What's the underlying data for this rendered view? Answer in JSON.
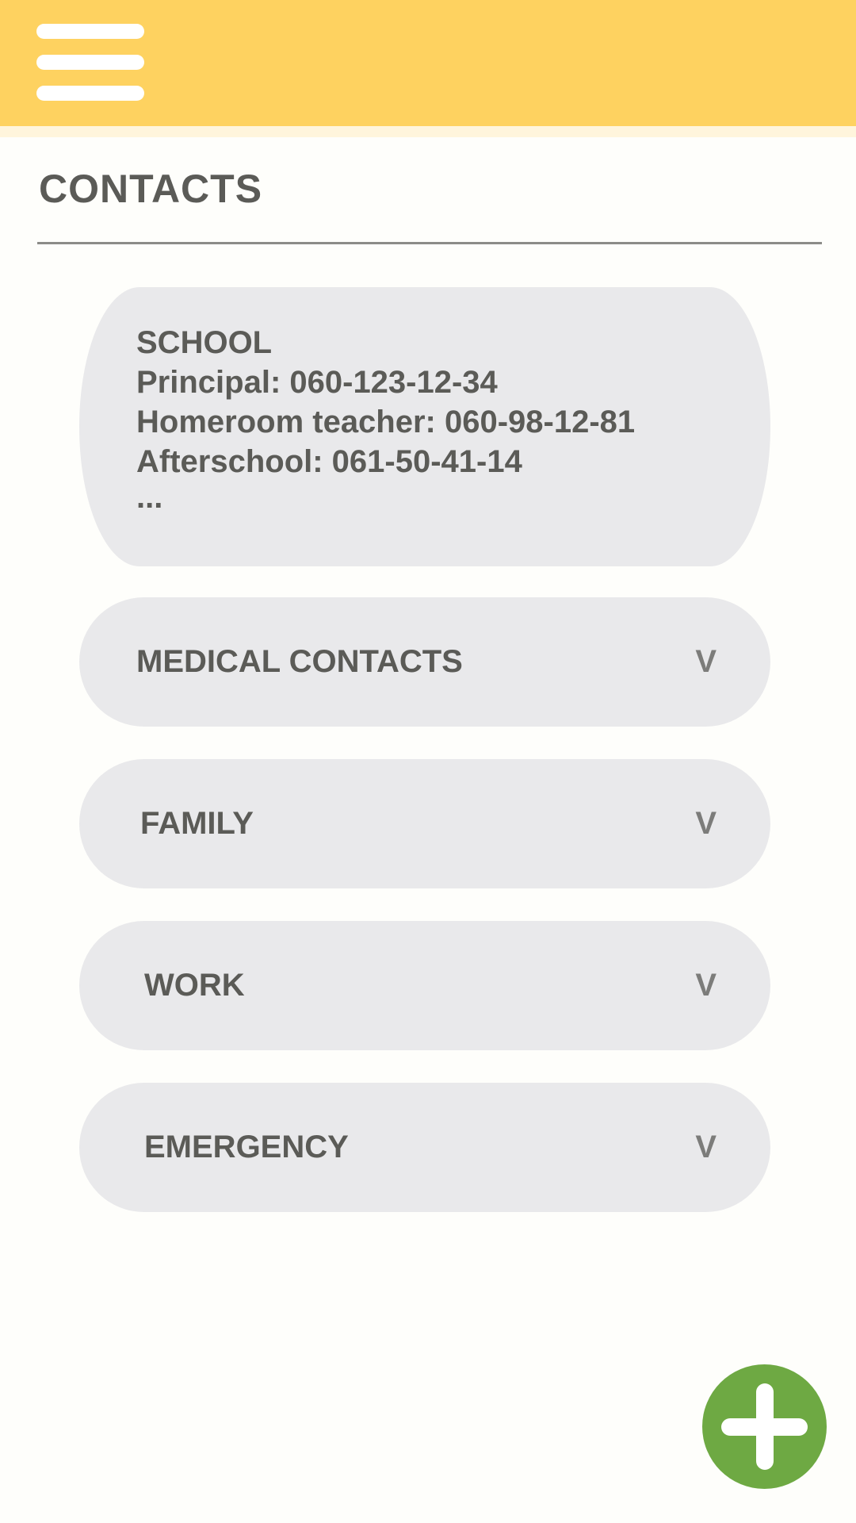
{
  "header": {
    "menu_icon": "hamburger-menu-icon",
    "background_color": "#fed260"
  },
  "page": {
    "title": "CONTACTS"
  },
  "categories": [
    {
      "label": "SCHOOL",
      "expanded": true,
      "entries": [
        "Principal: 060-123-12-34",
        "Homeroom teacher: 060-98-12-81",
        "Afterschool: 061-50-41-14"
      ],
      "more": "..."
    },
    {
      "label": "MEDICAL CONTACTS",
      "expanded": false,
      "toggle": "V"
    },
    {
      "label": "FAMILY",
      "expanded": false,
      "toggle": "V"
    },
    {
      "label": "WORK",
      "expanded": false,
      "toggle": "V"
    },
    {
      "label": "EMERGENCY",
      "expanded": false,
      "toggle": "V"
    }
  ],
  "fab": {
    "icon": "plus-icon",
    "color": "#6ea943"
  },
  "colors": {
    "card_background": "#e9e9eb",
    "text": "#5b5b57"
  }
}
